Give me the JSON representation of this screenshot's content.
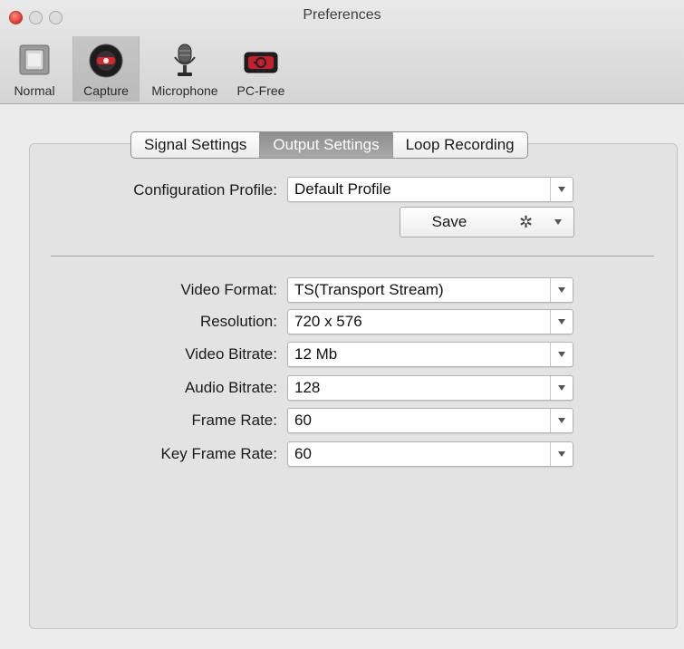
{
  "window": {
    "title": "Preferences"
  },
  "toolbar": {
    "items": [
      {
        "label": "Normal",
        "icon": "switch-icon"
      },
      {
        "label": "Capture",
        "icon": "record-icon",
        "selected": true
      },
      {
        "label": "Microphone",
        "icon": "microphone-icon"
      },
      {
        "label": "PC-Free",
        "icon": "pc-free-icon"
      }
    ]
  },
  "tabs": [
    {
      "label": "Signal Settings"
    },
    {
      "label": "Output Settings",
      "active": true
    },
    {
      "label": "Loop Recording"
    }
  ],
  "profile": {
    "label": "Configuration Profile:",
    "value": "Default Profile",
    "save_label": "Save",
    "gear_icon": "gear-icon"
  },
  "settings": [
    {
      "label": "Video Format:",
      "value": "TS(Transport Stream)"
    },
    {
      "label": "Resolution:",
      "value": "720 x 576"
    },
    {
      "label": "Video Bitrate:",
      "value": "12 Mb"
    },
    {
      "label": "Audio Bitrate:",
      "value": "128"
    },
    {
      "label": "Frame Rate:",
      "value": "60"
    },
    {
      "label": "Key Frame Rate:",
      "value": "60"
    }
  ],
  "colors": {
    "close": "#e0443a",
    "active_tab": "#9a9a9a"
  }
}
